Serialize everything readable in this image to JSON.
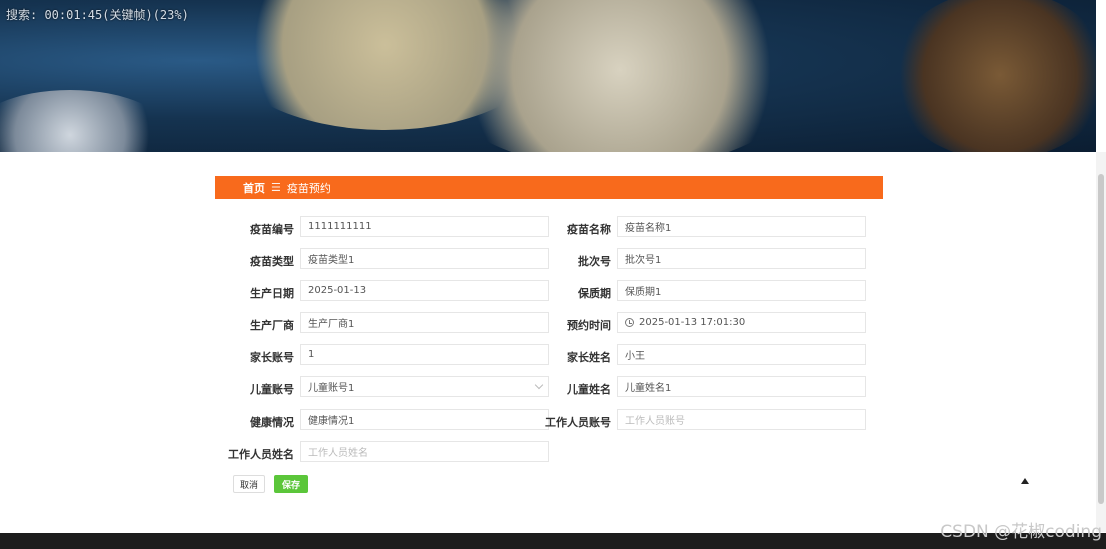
{
  "banner": {
    "overlay_text": "搜索: 00:01:45(关键帧)(23%)"
  },
  "breadcrumb": {
    "home": "首页",
    "separator": "☰",
    "current": "疫苗预约"
  },
  "form": {
    "vaccine_no_label": "疫苗编号",
    "vaccine_no_value": "1111111111",
    "vaccine_name_label": "疫苗名称",
    "vaccine_name_value": "疫苗名称1",
    "vaccine_type_label": "疫苗类型",
    "vaccine_type_value": "疫苗类型1",
    "batch_label": "批次号",
    "batch_value": "批次号1",
    "prod_date_label": "生产日期",
    "prod_date_value": "2025-01-13",
    "shelf_label": "保质期",
    "shelf_value": "保质期1",
    "maker_label": "生产厂商",
    "maker_value": "生产厂商1",
    "appt_time_label": "预约时间",
    "appt_time_value": "2025-01-13 17:01:30",
    "parent_acct_label": "家长账号",
    "parent_acct_value": "1",
    "parent_name_label": "家长姓名",
    "parent_name_value": "小王",
    "child_acct_label": "儿童账号",
    "child_acct_value": "儿童账号1",
    "child_name_label": "儿童姓名",
    "child_name_value": "儿童姓名1",
    "health_label": "健康情况",
    "health_value": "健康情况1",
    "staff_acct_label": "工作人员账号",
    "staff_acct_placeholder": "工作人员账号",
    "staff_name_label": "工作人员姓名",
    "staff_name_placeholder": "工作人员姓名"
  },
  "buttons": {
    "cancel": "取消",
    "save": "保存"
  },
  "watermark": "CSDN @花椒coding",
  "colors": {
    "accent": "#f86a1c",
    "save": "#5bc63a",
    "footer": "#1d1d1d"
  }
}
